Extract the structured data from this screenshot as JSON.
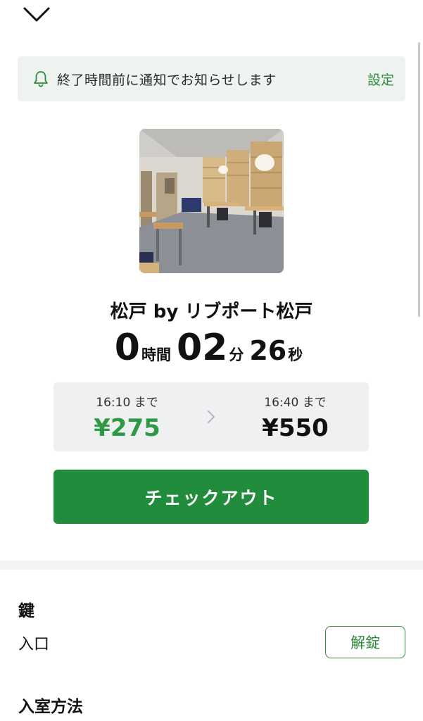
{
  "header": {
    "close_icon": "chevron-down-icon"
  },
  "notice": {
    "icon": "bell-icon",
    "message": "終了時間前に通知でお知らせします",
    "settings_label": "設定"
  },
  "store": {
    "name": "松戸 by リブポート松戸"
  },
  "timer": {
    "hours": "0",
    "hours_unit": "時間",
    "minutes": "02",
    "minutes_unit": "分",
    "seconds": "26",
    "seconds_unit": "秒"
  },
  "pricing": {
    "current": {
      "until": "16:10 まで",
      "price": "¥275"
    },
    "next": {
      "until": "16:40 まで",
      "price": "¥550"
    },
    "arrow_icon": "chevron-right-icon"
  },
  "checkout": {
    "label": "チェックアウト"
  },
  "key_section": {
    "title": "鍵",
    "entrance_label": "入口",
    "unlock_label": "解錠"
  },
  "entry_section": {
    "title": "入室方法"
  },
  "colors": {
    "accent": "#218c3b",
    "accent_text": "#2e9a43",
    "notice_bg": "#eef3ef",
    "price_box_bg": "#eff0f2"
  }
}
